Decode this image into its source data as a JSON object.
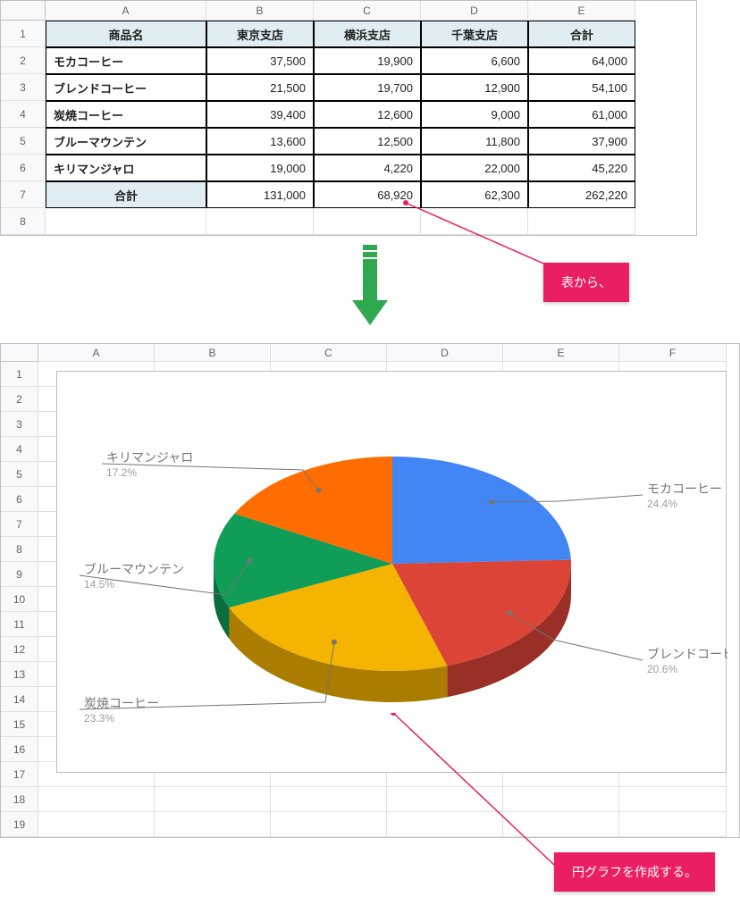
{
  "sheet1": {
    "colHeaders": [
      "A",
      "B",
      "C",
      "D",
      "E"
    ],
    "rowHeaders": [
      "1",
      "2",
      "3",
      "4",
      "5",
      "6",
      "7",
      "8"
    ],
    "headerRow": [
      "商品名",
      "東京支店",
      "横浜支店",
      "千葉支店",
      "合計"
    ],
    "rows": [
      {
        "name": "モカコーヒー",
        "vals": [
          "37,500",
          "19,900",
          "6,600",
          "64,000"
        ]
      },
      {
        "name": "ブレンドコーヒー",
        "vals": [
          "21,500",
          "19,700",
          "12,900",
          "54,100"
        ]
      },
      {
        "name": "炭焼コーヒー",
        "vals": [
          "39,400",
          "12,600",
          "9,000",
          "61,000"
        ]
      },
      {
        "name": "ブルーマウンテン",
        "vals": [
          "13,600",
          "12,500",
          "11,800",
          "37,900"
        ]
      },
      {
        "name": "キリマンジャロ",
        "vals": [
          "19,000",
          "4,220",
          "22,000",
          "45,220"
        ]
      }
    ],
    "totalLabel": "合計",
    "totals": [
      "131,000",
      "68,920",
      "62,300",
      "262,220"
    ]
  },
  "callout1": "表から、",
  "callout2": "円グラフを作成する。",
  "sheet2": {
    "colHeaders": [
      "A",
      "B",
      "C",
      "D",
      "E",
      "F"
    ],
    "rowHeaders": [
      "1",
      "2",
      "3",
      "4",
      "5",
      "6",
      "7",
      "8",
      "9",
      "10",
      "11",
      "12",
      "13",
      "14",
      "15",
      "16",
      "17",
      "18",
      "19"
    ]
  },
  "chart_data": {
    "type": "pie",
    "series": [
      {
        "name": "モカコーヒー",
        "value": 64000,
        "pct": "24.4%",
        "color": "#4285f4"
      },
      {
        "name": "ブレンドコーヒー",
        "value": 54100,
        "pct": "20.6%",
        "color": "#db4437"
      },
      {
        "name": "炭焼コーヒー",
        "value": 61000,
        "pct": "23.3%",
        "color": "#f4b400"
      },
      {
        "name": "ブルーマウンテン",
        "value": 37900,
        "pct": "14.5%",
        "color": "#0f9d58"
      },
      {
        "name": "キリマンジャロ",
        "value": 45220,
        "pct": "17.2%",
        "color": "#ff6d00"
      }
    ]
  }
}
